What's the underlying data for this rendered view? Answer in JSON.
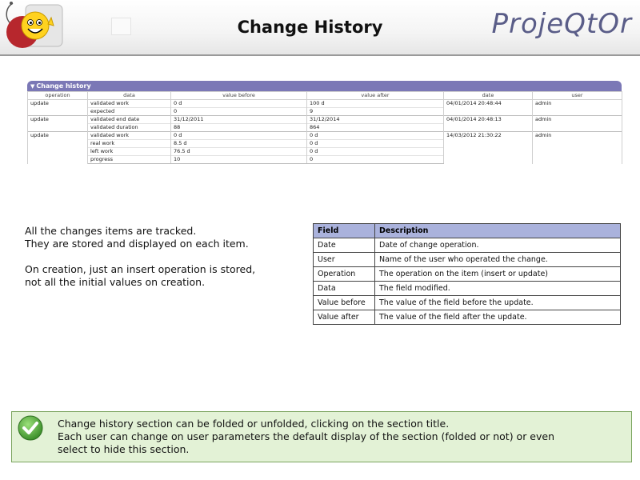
{
  "header": {
    "title": "Change History",
    "brand": "ProjeQtOr",
    "logo_icon": "mascot-logo-icon"
  },
  "history": {
    "title": "Change history",
    "columns": [
      "operation",
      "data",
      "value before",
      "value after",
      "date",
      "user"
    ],
    "groups": [
      {
        "operation": "update",
        "date": "04/01/2014 20:48:44",
        "user": "admin",
        "rows": [
          {
            "data": "validated work",
            "before": "0 d",
            "after": "100 d"
          },
          {
            "data": "expected",
            "before": "0",
            "after": "9"
          }
        ]
      },
      {
        "operation": "update",
        "date": "04/01/2014 20:48:13",
        "user": "admin",
        "rows": [
          {
            "data": "validated end date",
            "before": "31/12/2011",
            "after": "31/12/2014"
          },
          {
            "data": "validated duration",
            "before": "88",
            "after": "864"
          }
        ]
      },
      {
        "operation": "update",
        "date": "14/03/2012 21:30:22",
        "user": "admin",
        "rows": [
          {
            "data": "validated work",
            "before": "0 d",
            "after": "0 d"
          },
          {
            "data": "real work",
            "before": "8.5 d",
            "after": "0 d"
          },
          {
            "data": "left work",
            "before": "76.5 d",
            "after": "0 d"
          },
          {
            "data": "progress",
            "before": "10",
            "after": "0"
          }
        ]
      }
    ]
  },
  "body": {
    "para1_line1": "All the changes items are tracked.",
    "para1_line2": "They are stored and displayed on each item.",
    "para2_line1": "On creation, just an insert operation is stored,",
    "para2_line2": "not all the initial values on creation."
  },
  "fields_table": {
    "headers": [
      "Field",
      "Description"
    ],
    "rows": [
      [
        "Date",
        "Date of change operation."
      ],
      [
        "User",
        "Name of the user who operated the change."
      ],
      [
        "Operation",
        "The operation on the item (insert or update)"
      ],
      [
        "Data",
        "The field modified."
      ],
      [
        "Value before",
        "The value of the field before the update."
      ],
      [
        "Value after",
        "The value of the field after the update."
      ]
    ]
  },
  "tip": {
    "icon": "check-icon",
    "line1": "Change history section can be folded or unfolded, clicking on the section title.",
    "line2": "Each user can change on user parameters the default display of the section (folded or not) or even",
    "line3": "select to hide this section."
  },
  "colors": {
    "section_header": "#7b78b6",
    "table_header": "#aab2dc",
    "tip_background": "#e3f2d6",
    "tip_border": "#7aa45e",
    "brand": "#5a5d88"
  }
}
